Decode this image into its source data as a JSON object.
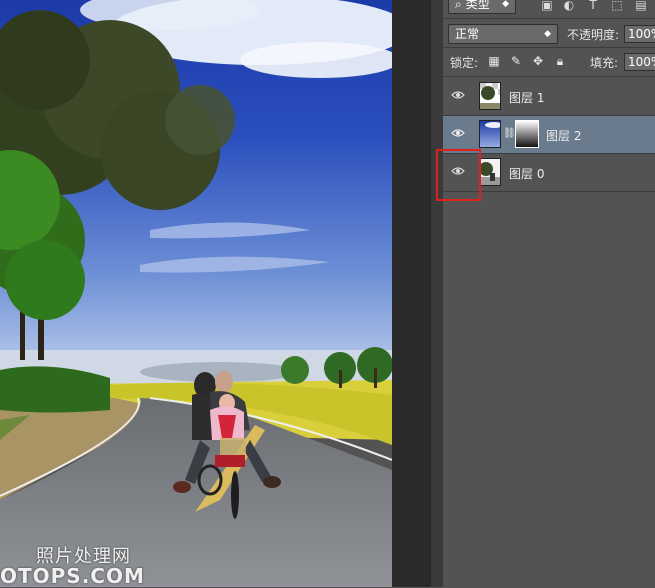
{
  "watermark": {
    "line1": "照片处理网",
    "line2": "OTOPS.COM"
  },
  "toolbar": {
    "filter_type": "类型",
    "filter_icons": [
      "image-filter-icon",
      "adjustment-filter-icon",
      "type-filter-icon",
      "shape-filter-icon",
      "smart-object-filter-icon"
    ]
  },
  "blend": {
    "mode": "正常",
    "opacity_label": "不透明度:",
    "opacity_value": "100%"
  },
  "lock": {
    "label": "锁定:",
    "fill_label": "填充:",
    "fill_value": "100%"
  },
  "layers": [
    {
      "name": "图层 1",
      "selected": false
    },
    {
      "name": "图层 2",
      "selected": true
    },
    {
      "name": "图层 0",
      "selected": false
    }
  ],
  "colors": {
    "panel": "#535353",
    "selected": "#6b7b8e",
    "highlight": "#e0201c"
  }
}
